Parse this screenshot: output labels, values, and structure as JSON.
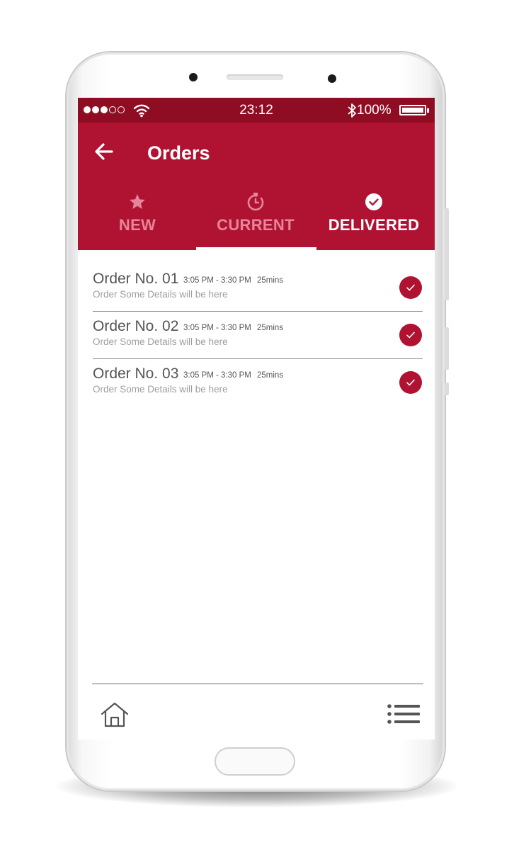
{
  "status_bar": {
    "time": "23:12",
    "battery_percent": "100%",
    "signal_bars_filled": 3,
    "signal_bars_total": 5
  },
  "app_bar": {
    "title": "Orders",
    "background_color": "#b01332",
    "status_bar_color": "#8f0d22"
  },
  "tabs": [
    {
      "label": "NEW",
      "icon": "star-icon",
      "active": false
    },
    {
      "label": "CURRENT",
      "icon": "timer-icon",
      "active": false
    },
    {
      "label": "DELIVERED",
      "icon": "check-circle-icon",
      "active": true
    }
  ],
  "orders": [
    {
      "title": "Order No. 01",
      "time": "3:05 PM - 3:30 PM",
      "duration": "25mins",
      "details": "Order Some Details will be here",
      "status_icon": "check-icon"
    },
    {
      "title": "Order No. 02",
      "time": "3:05 PM - 3:30 PM",
      "duration": "25mins",
      "details": "Order Some Details will be here",
      "status_icon": "check-icon"
    },
    {
      "title": "Order No. 03",
      "time": "3:05 PM - 3:30 PM",
      "duration": "25mins",
      "details": "Order Some Details will be here",
      "status_icon": "check-icon"
    }
  ],
  "bottom_nav": {
    "left_icon": "home-icon",
    "right_icon": "menu-list-icon"
  }
}
